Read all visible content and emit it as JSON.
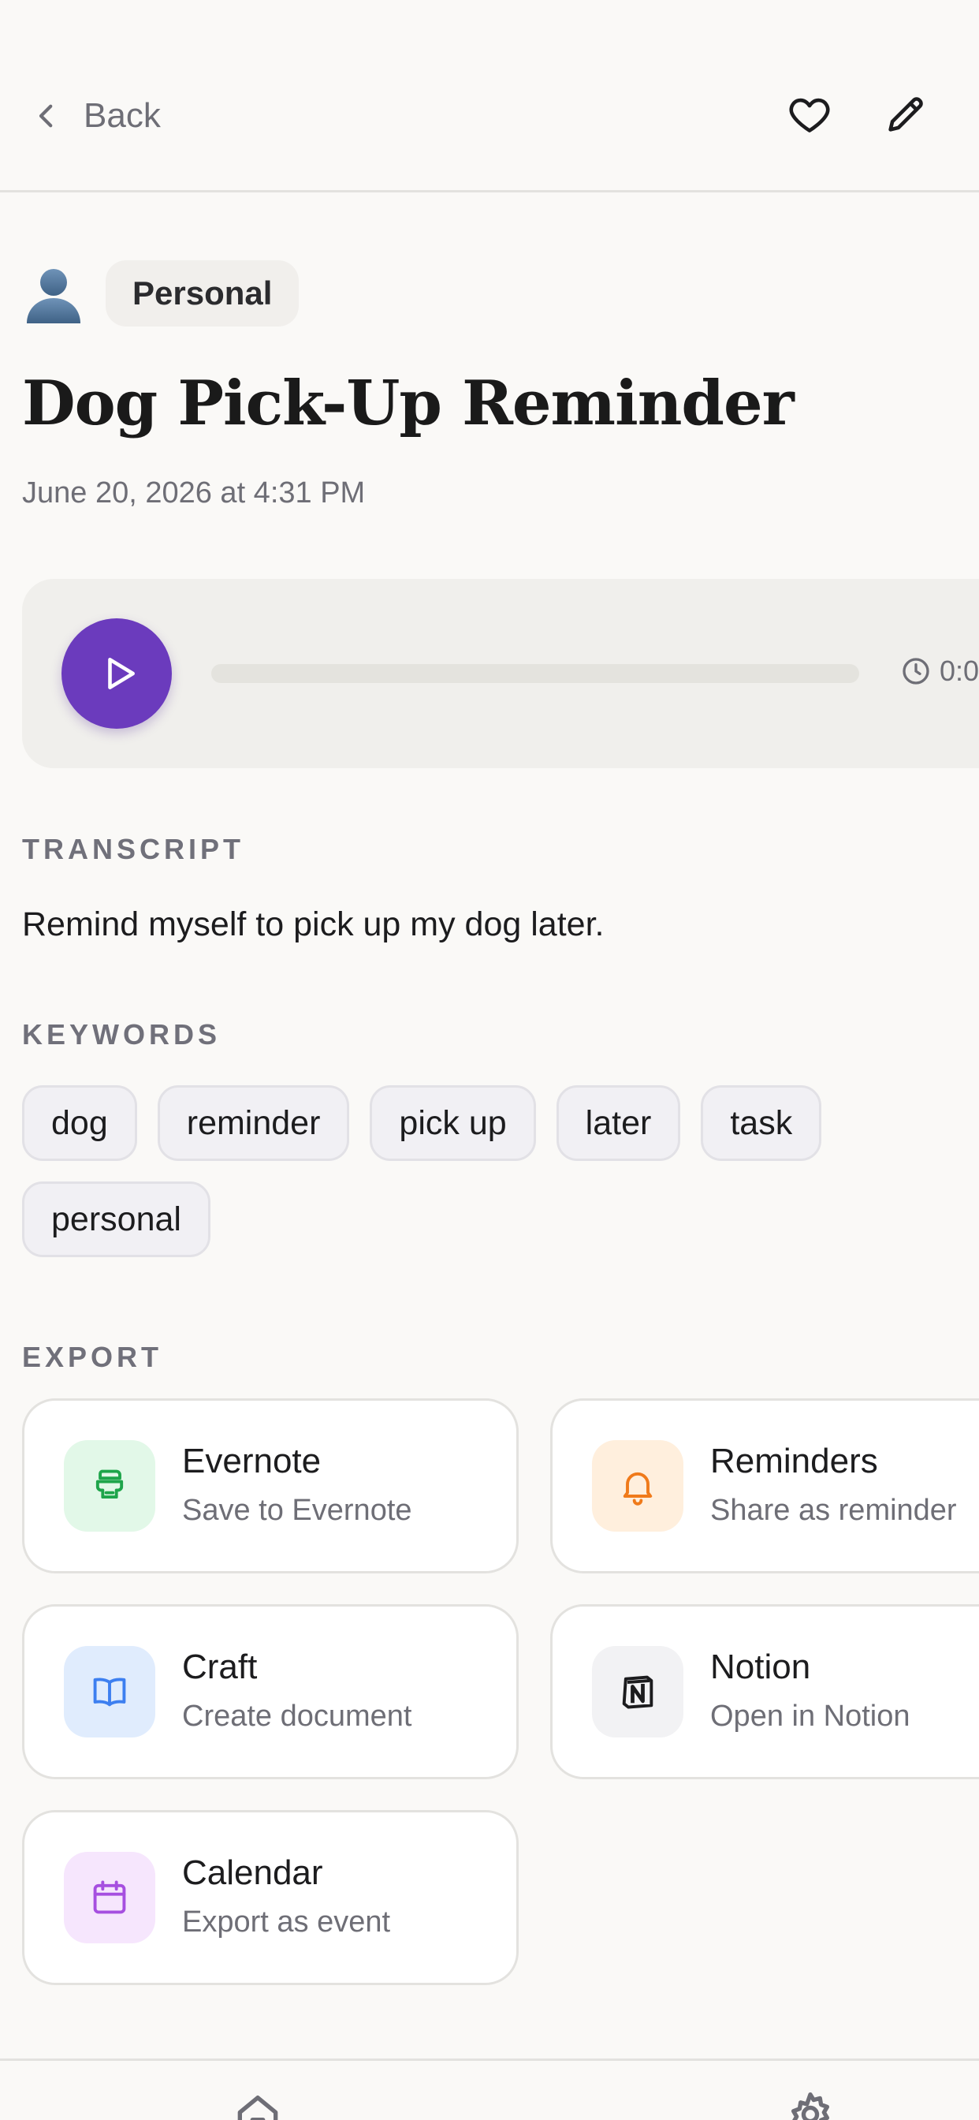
{
  "header": {
    "back_label": "Back",
    "icons": {
      "back": "chevron-left-icon",
      "favorite": "heart-icon",
      "edit": "pencil-icon"
    }
  },
  "note": {
    "category": "Personal",
    "category_icon": "person-silhouette-icon",
    "title": "Dog Pick-Up Reminder",
    "date": "June 20, 2026 at 4:31 PM"
  },
  "player": {
    "duration": "0:0",
    "progress": 0,
    "accent": "#6b3bbd",
    "icons": {
      "play": "play-icon",
      "clock": "clock-icon"
    }
  },
  "transcript": {
    "label": "TRANSCRIPT",
    "text": "Remind myself to pick up my dog later."
  },
  "keywords": {
    "label": "KEYWORDS",
    "items": [
      "dog",
      "reminder",
      "pick up",
      "later",
      "task",
      "personal"
    ]
  },
  "export": {
    "label": "EXPORT",
    "items": [
      {
        "title": "Evernote",
        "subtitle": "Save to Evernote",
        "icon": "evernote-icon",
        "color": "#1ea54a",
        "bg": "#e2f8e8"
      },
      {
        "title": "Reminders",
        "subtitle": "Share as reminder",
        "icon": "bell-icon",
        "color": "#f07a1a",
        "bg": "#ffefdd"
      },
      {
        "title": "Craft",
        "subtitle": "Create document",
        "icon": "open-book-icon",
        "color": "#3d7ff0",
        "bg": "#e0ecfd"
      },
      {
        "title": "Notion",
        "subtitle": "Open in Notion",
        "icon": "notion-icon",
        "color": "#1c1c1e",
        "bg": "#f2f2f4"
      },
      {
        "title": "Calendar",
        "subtitle": "Export as event",
        "icon": "calendar-icon",
        "color": "#a64fe0",
        "bg": "#f6e6fd"
      }
    ]
  },
  "bottom_nav": {
    "icons": [
      "home-icon",
      "gear-icon"
    ]
  }
}
